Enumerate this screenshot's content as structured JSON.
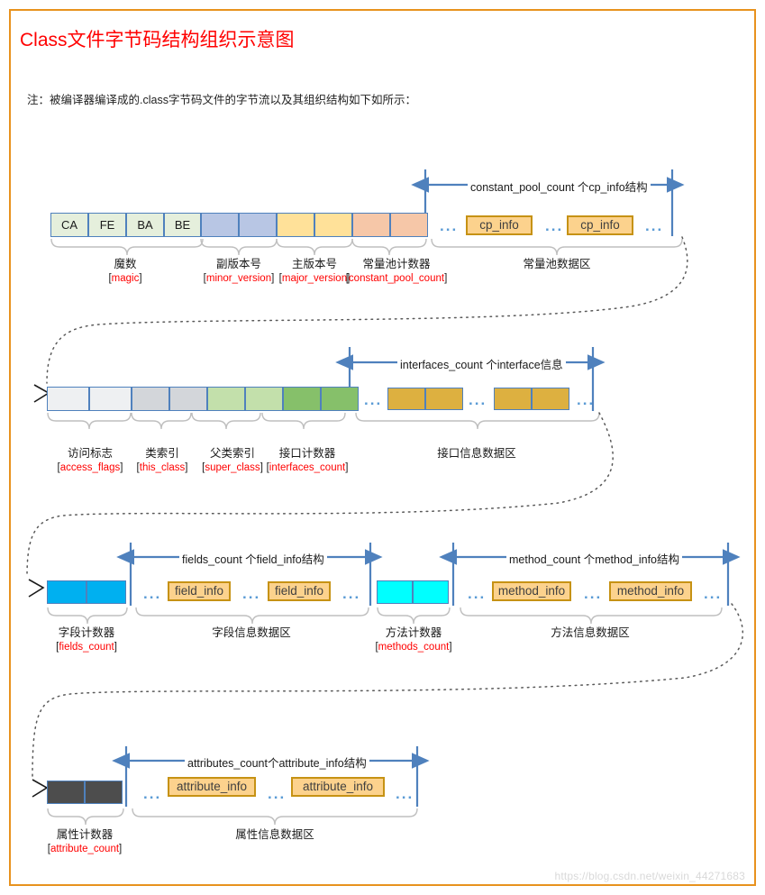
{
  "page": {
    "title": "Class文件字节码结构组织示意图",
    "note": "注：被编译器编译成的.class字节码文件的字节流以及其组织结构如下如所示：",
    "watermark": "https://blog.csdn.net/weixin_44271683",
    "colors": {
      "frame_border": "#e8921e",
      "title": "#ff0000",
      "cell_border": "#4f81bd",
      "arrow": "#4f81bd",
      "tag_border": "#c69214",
      "tag_fill": "#fcd28d",
      "dots": "#5b9bd5",
      "brace": "#bfbfbf",
      "code_red": "#ff0000",
      "magic_fill": "#e5efdc",
      "minor_fill": "#b8c6e4",
      "major_fill": "#ffe199",
      "cp_count_fill": "#f6c7a8",
      "access_flags_fill": "#eef0f2",
      "this_class_fill": "#d3d6da",
      "super_class_fill": "#c3e0ab",
      "interfaces_count_fill": "#86c06a",
      "interface_fill": "#ddb040",
      "fields_count_fill": "#00b0f0",
      "methods_count_fill": "#00ffff",
      "attribute_count_fill": "#4d4d4d"
    }
  },
  "rows": [
    {
      "id": "row1",
      "name": "constant-pool-row",
      "bytes": [
        "CA",
        "FE",
        "BA",
        "BE"
      ],
      "segments": [
        {
          "label": "魔数",
          "code": "magic"
        },
        {
          "label": "副版本号",
          "code": "minor_version"
        },
        {
          "label": "主版本号",
          "code": "major_version"
        },
        {
          "label": "常量池计数器",
          "code": "constant_pool_count"
        }
      ],
      "span_label": "constant_pool_count 个cp_info结构",
      "data_area_label": "常量池数据区",
      "items": [
        "cp_info",
        "cp_info"
      ]
    },
    {
      "id": "row2",
      "name": "interfaces-row",
      "segments": [
        {
          "label": "访问标志",
          "code": "access_flags"
        },
        {
          "label": "类索引",
          "code": "this_class"
        },
        {
          "label": "父类索引",
          "code": "super_class"
        },
        {
          "label": "接口计数器",
          "code": "interfaces_count"
        }
      ],
      "span_label": "interfaces_count 个interface信息",
      "data_area_label": "接口信息数据区"
    },
    {
      "id": "row3",
      "name": "fields-methods-row",
      "segments": [
        {
          "label": "字段计数器",
          "code": "fields_count"
        },
        {
          "label": "方法计数器",
          "code": "methods_count"
        }
      ],
      "span_label_fields": "fields_count 个field_info结构",
      "span_label_methods": "method_count 个method_info结构",
      "data_area_fields": "字段信息数据区",
      "data_area_methods": "方法信息数据区",
      "items_fields": [
        "field_info",
        "field_info"
      ],
      "items_methods": [
        "method_info",
        "method_info"
      ]
    },
    {
      "id": "row4",
      "name": "attributes-row",
      "segments": [
        {
          "label": "属性计数器",
          "code": "attribute_count"
        }
      ],
      "span_label": "attributes_count个attribute_info结构",
      "data_area_label": "属性信息数据区",
      "items": [
        "attribute_info",
        "attribute_info"
      ]
    }
  ]
}
